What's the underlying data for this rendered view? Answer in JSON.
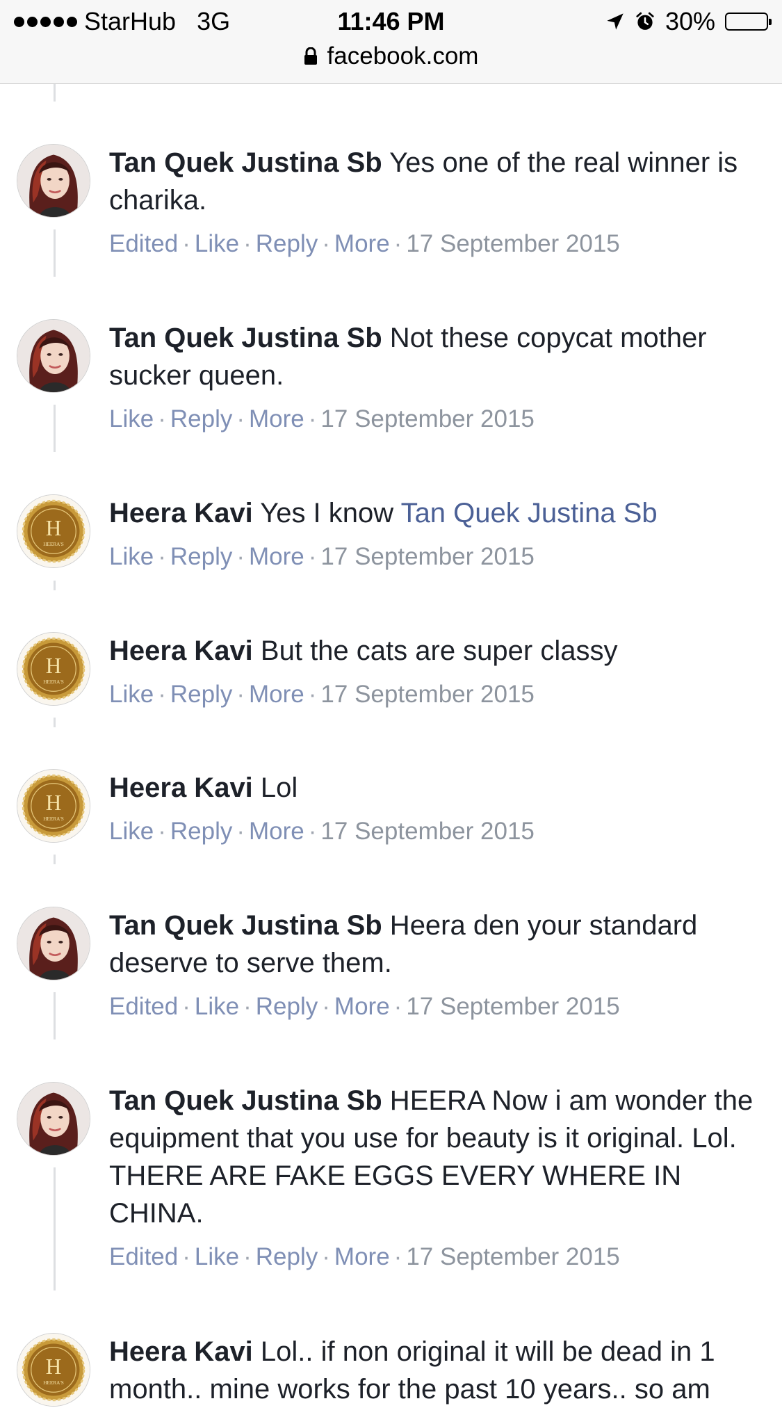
{
  "status_bar": {
    "carrier": "StarHub",
    "network": "3G",
    "time": "11:46 PM",
    "battery": "30%",
    "battery_level": 0.3,
    "battery_color": "#f5c800",
    "url": "facebook.com",
    "icons": [
      "signal-dots-icon",
      "location-arrow-icon",
      "alarm-clock-icon",
      "lock-icon",
      "battery-icon"
    ]
  },
  "actions": {
    "edited": "Edited",
    "like": "Like",
    "reply": "Reply",
    "more": "More"
  },
  "comments": [
    {
      "author": "Tan Quek Justina Sb",
      "text": " Yes one of the real winner is charika.",
      "date": "17 September 2015",
      "edited": true
    },
    {
      "author": "Tan Quek Justina Sb",
      "text": " Not these copycat mother sucker queen.",
      "date": "17 September 2015",
      "edited": false
    },
    {
      "author": "Heera Kavi",
      "text": " Yes I know ",
      "mention": "Tan Quek Justina Sb",
      "date": "17 September 2015",
      "edited": false
    },
    {
      "author": "Heera Kavi",
      "text": " But the cats are super classy",
      "date": "17 September 2015",
      "edited": false
    },
    {
      "author": "Heera Kavi",
      "text": " Lol",
      "date": "17 September 2015",
      "edited": false
    },
    {
      "author": "Tan Quek Justina Sb",
      "text": " Heera den your standard deserve to serve them.",
      "date": "17 September 2015",
      "edited": true
    },
    {
      "author": "Tan Quek Justina Sb",
      "text": " HEERA Now i am wonder the equipment that you use for beauty is it original. Lol. THERE ARE FAKE EGGS EVERY WHERE IN CHINA.",
      "date": "17 September 2015",
      "edited": true
    },
    {
      "author": "Heera Kavi",
      "text": " Lol.. if non original it will be dead in 1 month.. mine works for the past 10 years.. so am"
    }
  ],
  "avatars": {
    "heera_logo_letter": "H",
    "heera_logo_text": "HEERA'S"
  },
  "colors": {
    "link": "#4b6096",
    "action": "#7f8fb5",
    "meta": "#8d949e",
    "thread_line": "#dddfe2",
    "text": "#1d2129"
  }
}
